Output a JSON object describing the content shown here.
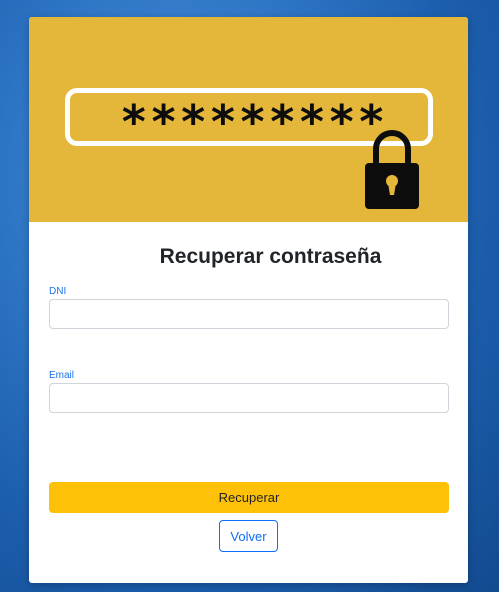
{
  "banner": {
    "password_mask": "*********",
    "icon": "padlock-icon",
    "background_color": "#e4b63a"
  },
  "form": {
    "title": "Recuperar contraseña",
    "dni": {
      "label": "DNI",
      "value": "",
      "placeholder": ""
    },
    "email": {
      "label": "Email",
      "value": "",
      "placeholder": ""
    },
    "submit_label": "Recuperar",
    "back_label": "Volver"
  },
  "colors": {
    "accent_yellow": "#ffc107",
    "link_blue": "#0d6efd",
    "label_blue": "#1a73e8"
  }
}
